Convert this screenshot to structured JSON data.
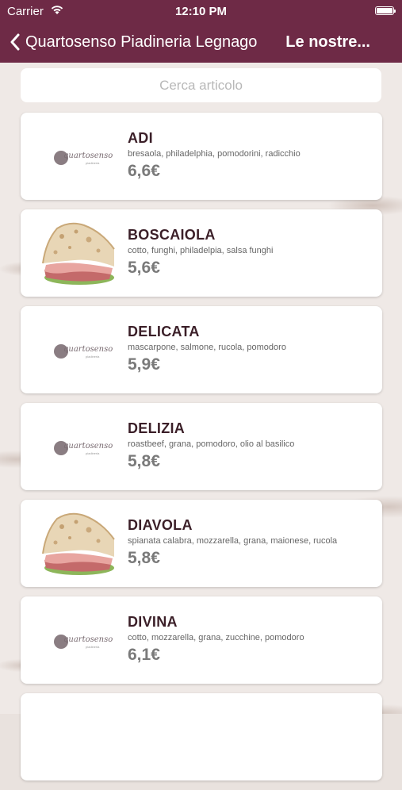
{
  "status_bar": {
    "carrier": "Carrier",
    "time": "12:10 PM"
  },
  "nav": {
    "back_label": "Quartosenso Piadineria Legnago",
    "title": "Le nostre..."
  },
  "search": {
    "placeholder": "Cerca articolo"
  },
  "logo": {
    "word": "quartosenso",
    "sub": "piadineria"
  },
  "items": [
    {
      "name": "ADI",
      "ingredients": "bresaola, philadelphia, pomodorini, radicchio",
      "price": "6,6€",
      "image": "logo"
    },
    {
      "name": "BOSCAIOLA",
      "ingredients": "cotto, funghi, philadelpia, salsa funghi",
      "price": "5,6€",
      "image": "piadina-photo"
    },
    {
      "name": "DELICATA",
      "ingredients": "mascarpone, salmone, rucola, pomodoro",
      "price": "5,9€",
      "image": "logo"
    },
    {
      "name": "DELIZIA",
      "ingredients": "roastbeef, grana, pomodoro, olio al basilico",
      "price": "5,8€",
      "image": "logo"
    },
    {
      "name": "DIAVOLA",
      "ingredients": "spianata calabra, mozzarella, grana, maionese, rucola",
      "price": "5,8€",
      "image": "piadina-photo"
    },
    {
      "name": "DIVINA",
      "ingredients": "cotto, mozzarella, grana, zucchine, pomodoro",
      "price": "6,1€",
      "image": "logo"
    }
  ],
  "colors": {
    "header": "#6e2a46",
    "item_name": "#3b1f28",
    "price": "#7a7a7a"
  }
}
